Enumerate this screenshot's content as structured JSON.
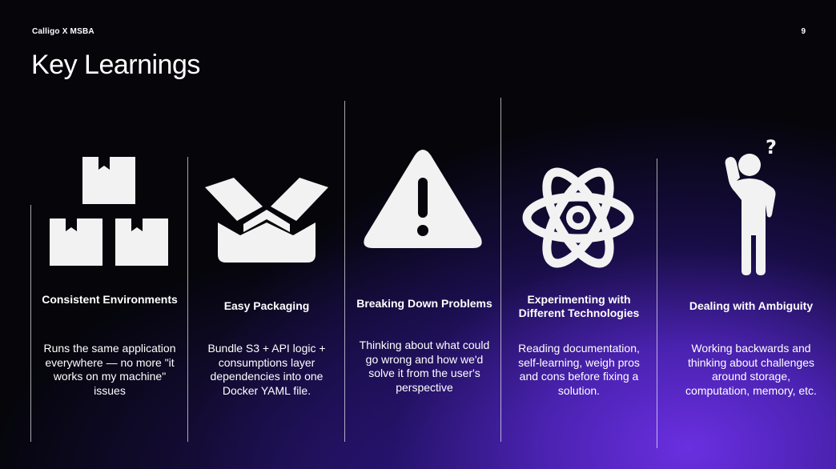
{
  "header": {
    "left_label": "Calligo X MSBA",
    "page_number": "9"
  },
  "title": "Key Learnings",
  "colors": {
    "background": "#05050a",
    "accent_purple": "#6a2fe0",
    "icon_fill": "#f2f2f2"
  },
  "columns": [
    {
      "icon": "stacked-boxes-icon",
      "heading": "Consistent Environments",
      "body": "Runs the same application everywhere — no more \"it works on my machine\" issues"
    },
    {
      "icon": "open-box-icon",
      "heading": "Easy Packaging",
      "body": "Bundle S3 + API logic + consumptions layer dependencies into one Docker YAML file."
    },
    {
      "icon": "warning-icon",
      "heading": "Breaking Down Problems",
      "body": "Thinking about what could go wrong and how we'd solve it from the user's perspective"
    },
    {
      "icon": "atom-icon",
      "heading": "Experimenting with Different Technologies",
      "body": "Reading documentation, self-learning, weigh pros and cons before fixing a solution."
    },
    {
      "icon": "confused-person-icon",
      "heading": "Dealing with Ambiguity",
      "body": "Working backwards and thinking about challenges around storage, computation, memory, etc."
    }
  ]
}
